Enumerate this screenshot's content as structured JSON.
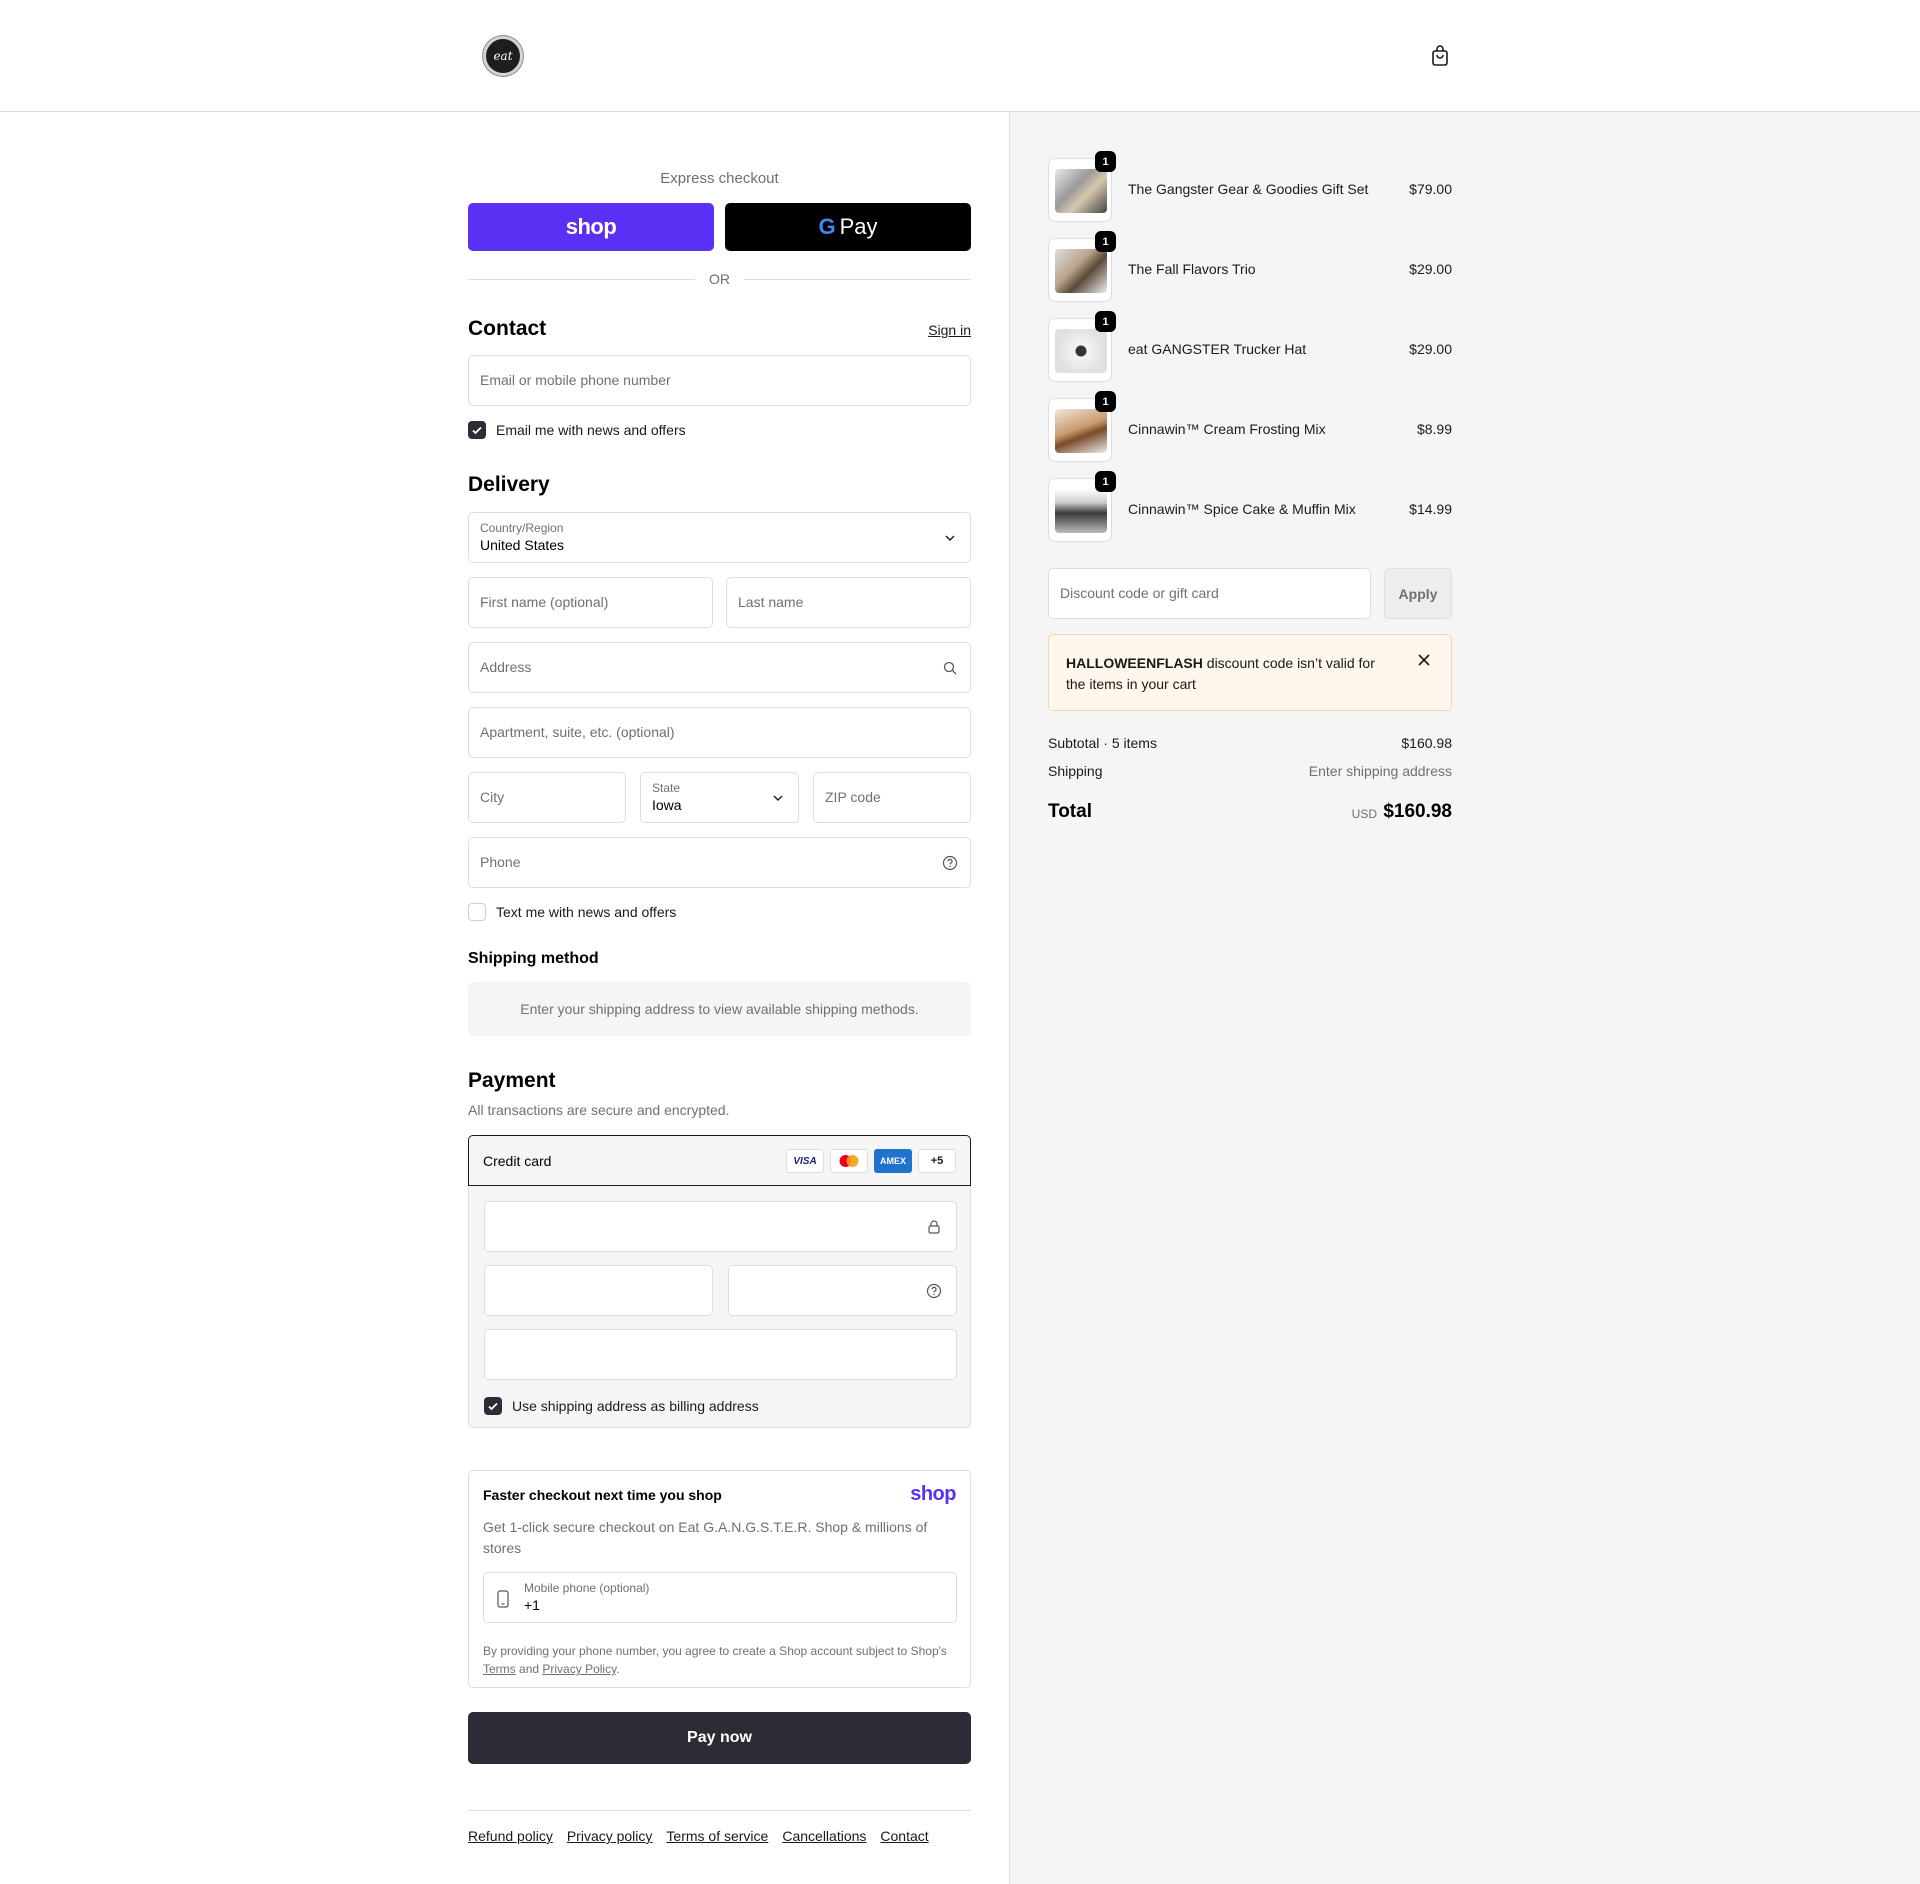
{
  "header": {
    "logo_text": "eat",
    "cart_icon": "shopping-bag-icon"
  },
  "express": {
    "title": "Express checkout",
    "shop_label": "shop",
    "gpay_g": "G",
    "gpay_label": "Pay",
    "or_label": "OR"
  },
  "contact": {
    "title": "Contact",
    "signin_label": "Sign in",
    "email_placeholder": "Email or mobile phone number",
    "newsletter_label": "Email me with news and offers",
    "newsletter_checked": true
  },
  "delivery": {
    "title": "Delivery",
    "country_label": "Country/Region",
    "country_value": "United States",
    "first_name_placeholder": "First name (optional)",
    "last_name_placeholder": "Last name",
    "address_placeholder": "Address",
    "apartment_placeholder": "Apartment, suite, etc. (optional)",
    "city_placeholder": "City",
    "state_label": "State",
    "state_value": "Iowa",
    "zip_placeholder": "ZIP code",
    "phone_placeholder": "Phone",
    "sms_label": "Text me with news and offers",
    "sms_checked": false
  },
  "shipping_method": {
    "title": "Shipping method",
    "message": "Enter your shipping address to view available shipping methods."
  },
  "payment": {
    "title": "Payment",
    "subtitle": "All transactions are secure and encrypted.",
    "method_label": "Credit card",
    "card_brands": [
      "VISA",
      "MC",
      "AMEX",
      "+5"
    ],
    "billing_label": "Use shipping address as billing address",
    "billing_checked": true
  },
  "shop_pay": {
    "title": "Faster checkout next time you shop",
    "brand": "shop",
    "description": "Get 1-click secure checkout on Eat G.A.N.G.S.T.E.R. Shop & millions of stores",
    "mobile_label": "Mobile phone (optional)",
    "mobile_value": "+1",
    "legal_prefix": "By providing your phone number, you agree to create a Shop account subject to Shop's",
    "legal_terms": "Terms",
    "legal_and": "and",
    "legal_privacy": "Privacy Policy",
    "legal_end": "."
  },
  "pay_now_label": "Pay now",
  "footer_links": [
    "Refund policy",
    "Privacy policy",
    "Terms of service",
    "Cancellations",
    "Contact"
  ],
  "order": {
    "items": [
      {
        "name": "The Gangster Gear & Goodies Gift Set",
        "price": "$79.00",
        "qty": "1"
      },
      {
        "name": "The Fall Flavors Trio",
        "price": "$29.00",
        "qty": "1"
      },
      {
        "name": "eat GANGSTER Trucker Hat",
        "price": "$29.00",
        "qty": "1"
      },
      {
        "name": "Cinnawin™ Cream Frosting Mix",
        "price": "$8.99",
        "qty": "1"
      },
      {
        "name": "Cinnawin™ Spice Cake & Muffin Mix",
        "price": "$14.99",
        "qty": "1"
      }
    ],
    "discount_placeholder": "Discount code or gift card",
    "apply_label": "Apply",
    "alert_code": "HALLOWEENFLASH",
    "alert_message": " discount code isn’t valid for the items in your cart",
    "subtotal_label": "Subtotal · 5 items",
    "subtotal_value": "$160.98",
    "shipping_label": "Shipping",
    "shipping_value": "Enter shipping address",
    "total_label": "Total",
    "currency": "USD",
    "total_value": "$160.98"
  },
  "colors": {
    "shop_purple": "#5a31f4",
    "dark_button": "#2c2c36",
    "alert_bg": "#fff6ec"
  }
}
